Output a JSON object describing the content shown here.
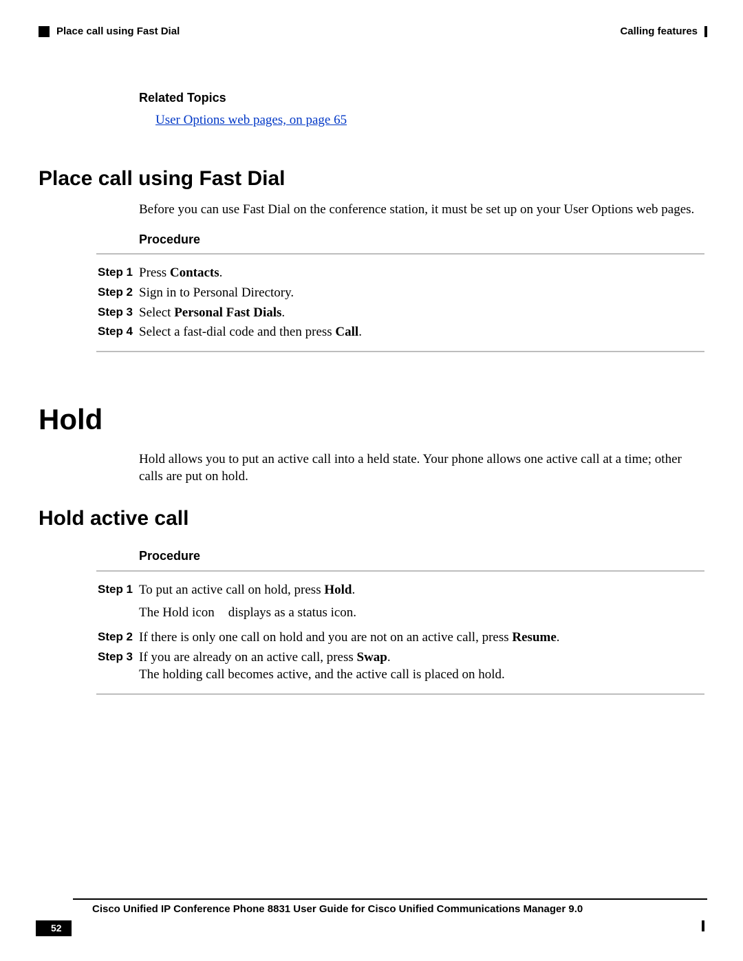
{
  "header": {
    "section_title": "Place call using Fast Dial",
    "chapter_title": "Calling features"
  },
  "related": {
    "heading": "Related Topics",
    "link": "User Options web pages,  on page 65"
  },
  "section1": {
    "title": "Place call using Fast Dial",
    "intro": "Before you can use Fast Dial on the conference station, it must be set up on your User Options web pages.",
    "procedure_label": "Procedure",
    "steps": [
      {
        "label": "Step 1",
        "pre": "Press ",
        "bold": "Contacts",
        "post": "."
      },
      {
        "label": "Step 2",
        "pre": "Sign in to Personal Directory.",
        "bold": "",
        "post": ""
      },
      {
        "label": "Step 3",
        "pre": "Select ",
        "bold": "Personal Fast Dials",
        "post": "."
      },
      {
        "label": "Step 4",
        "pre": "Select a fast-dial code and then press ",
        "bold": "Call",
        "post": "."
      }
    ]
  },
  "section2": {
    "title": "Hold",
    "intro": "Hold allows you to put an active call into a held state. Your phone allows one active call at a time; other calls are put on hold."
  },
  "section3": {
    "title": "Hold active call",
    "procedure_label": "Procedure",
    "steps": [
      {
        "label": "Step 1",
        "line1_pre": "To put an active call on hold, press ",
        "line1_bold": "Hold",
        "line1_post": ".",
        "line2_a": "The Hold icon",
        "line2_b": "displays as a status icon."
      },
      {
        "label": "Step 2",
        "line1_pre": "If there is only one call on hold and you are not on an active call, press ",
        "line1_bold": "Resume",
        "line1_post": "."
      },
      {
        "label": "Step 3",
        "line1_pre": "If you are already on an active call, press ",
        "line1_bold": "Swap",
        "line1_post": ".",
        "line2": "The holding call becomes active, and the active call is placed on hold."
      }
    ]
  },
  "footer": {
    "title": "Cisco Unified IP Conference Phone 8831 User Guide for Cisco Unified Communications Manager 9.0",
    "page": "52"
  }
}
